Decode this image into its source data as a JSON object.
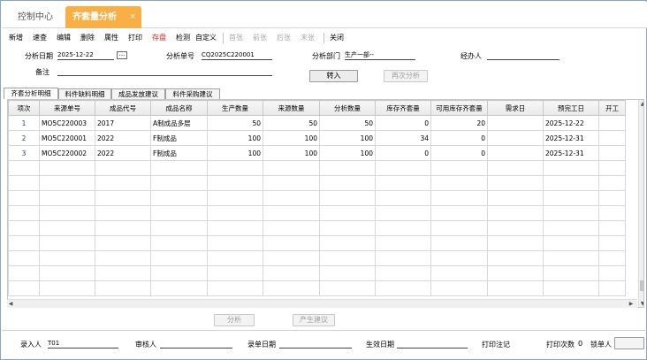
{
  "tabs": {
    "home": "控制中心",
    "active": "齐套量分析",
    "close": "×"
  },
  "toolbar": [
    "新增",
    "速查",
    "编辑",
    "删除",
    "属性",
    "打印",
    "存盘",
    "检测",
    "自定义",
    "首张",
    "前张",
    "后张",
    "末张",
    "关闭"
  ],
  "form": {
    "date_label": "分析日期",
    "date_value": "2025-12-22",
    "picker": "...",
    "order_label": "分析单号",
    "order_value": "CQ2025C220001",
    "dept_label": "分析部门",
    "dept_value": "生产一部--",
    "manager_label": "经办人",
    "manager_value": "",
    "remark_label": "备注",
    "remark_value": "",
    "import_button": "转入",
    "reanalyze_button": "再次分析"
  },
  "subtabs": [
    "齐套分析明细",
    "料件缺料明细",
    "成品发放建议",
    "料件采购建议"
  ],
  "grid": {
    "columns": [
      "项次",
      "来源单号",
      "成品代号",
      "成品名称",
      "生产数量",
      "来源数量",
      "分析数量",
      "库存齐套量",
      "可用库存齐套量",
      "需求日",
      "预完工日",
      "开工"
    ],
    "rows": [
      [
        "1",
        "MO5C220003",
        "2017",
        "A制成品多层",
        "50",
        "50",
        "50",
        "0",
        "20",
        "",
        "2025-12-22",
        ""
      ],
      [
        "2",
        "MO5C220001",
        "2022",
        "F制成品",
        "100",
        "100",
        "100",
        "34",
        "0",
        "",
        "2025-12-31",
        ""
      ],
      [
        "3",
        "MO5C220002",
        "2022",
        "F制成品",
        "100",
        "100",
        "100",
        "0",
        "0",
        "",
        "2025-12-31",
        ""
      ]
    ]
  },
  "bottom_buttons": {
    "analyze": "分析",
    "suggest": "产生建议"
  },
  "footer": {
    "entered_by_label": "录入人",
    "entered_by_value": "T01",
    "reviewer_label": "审核人",
    "reviewer_value": "",
    "entry_date_label": "录单日期",
    "entry_date_value": "",
    "effective_date_label": "生效日期",
    "effective_date_value": "",
    "print_note_label": "打印注记",
    "print_count_label": "打印次数",
    "print_count_value": "0",
    "locker_label": "锁单人"
  },
  "colors": {
    "accent": "#f8b046",
    "save_red": "#e02020",
    "index_blue": "#1a3fa0"
  }
}
